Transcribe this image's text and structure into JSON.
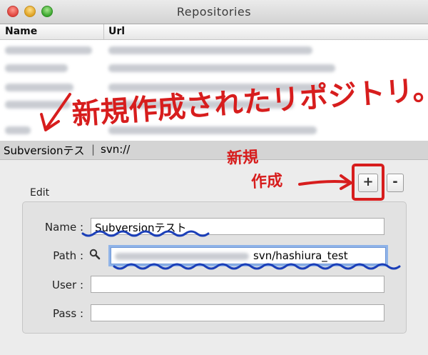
{
  "window": {
    "title": "Repositories"
  },
  "table": {
    "columns": {
      "name": "Name",
      "url": "Url"
    },
    "selected_row": {
      "name": "Subversionテス",
      "url": "svn://"
    }
  },
  "buttons": {
    "add": "+",
    "remove": "-"
  },
  "edit": {
    "group_label": "Edit",
    "name_label": "Name :",
    "name_value": "Subversionテスト",
    "path_label": "Path :",
    "path_value": "svn/hashiura_test",
    "user_label": "User :",
    "user_value": "",
    "pass_label": "Pass :",
    "pass_value": ""
  },
  "annotations": {
    "main_note": "新規作成されたリポジトリ。",
    "new_line1": "新規",
    "new_line2": "作成"
  },
  "colors": {
    "annotation_red": "#d71d1d",
    "annotation_blue": "#1b3fb8",
    "focus_ring": "#8fb3e8"
  }
}
